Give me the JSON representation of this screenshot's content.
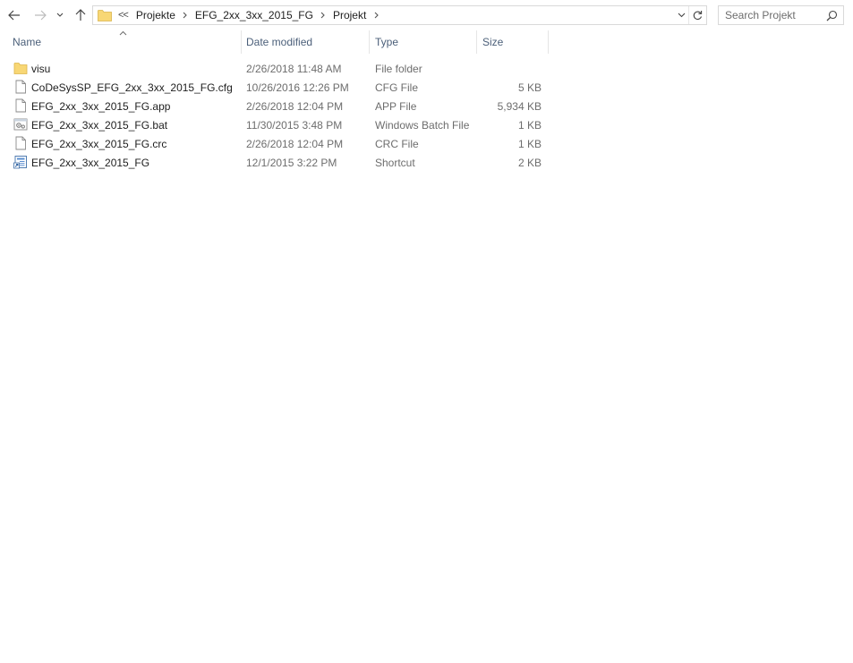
{
  "navigation": {
    "back_icon": "arrow-left-icon",
    "forward_icon": "arrow-right-icon",
    "recent_icon": "chevron-down-icon",
    "up_icon": "arrow-up-icon"
  },
  "address_bar": {
    "folder_icon": "folder-icon",
    "overflow": "<<",
    "crumbs": [
      "Projekte",
      "EFG_2xx_3xx_2015_FG",
      "Projekt"
    ],
    "dropdown_icon": "chevron-down-icon",
    "refresh_icon": "refresh-icon"
  },
  "search": {
    "placeholder": "Search Projekt",
    "value": "",
    "icon": "search-icon"
  },
  "columns": {
    "name": "Name",
    "date_modified": "Date modified",
    "type": "Type",
    "size": "Size",
    "sort_icon": "sort-ascending-icon"
  },
  "files": [
    {
      "name": "visu",
      "date": "2/26/2018 11:48 AM",
      "type": "File folder",
      "size": "",
      "icon": "folder-icon"
    },
    {
      "name": "CoDeSysSP_EFG_2xx_3xx_2015_FG.cfg",
      "date": "10/26/2016 12:26 PM",
      "type": "CFG File",
      "size": "5 KB",
      "icon": "file-icon"
    },
    {
      "name": "EFG_2xx_3xx_2015_FG.app",
      "date": "2/26/2018 12:04 PM",
      "type": "APP File",
      "size": "5,934 KB",
      "icon": "file-icon"
    },
    {
      "name": "EFG_2xx_3xx_2015_FG.bat",
      "date": "11/30/2015 3:48 PM",
      "type": "Windows Batch File",
      "size": "1 KB",
      "icon": "batch-file-icon"
    },
    {
      "name": "EFG_2xx_3xx_2015_FG.crc",
      "date": "2/26/2018 12:04 PM",
      "type": "CRC File",
      "size": "1 KB",
      "icon": "file-icon"
    },
    {
      "name": "EFG_2xx_3xx_2015_FG",
      "date": "12/1/2015 3:22 PM",
      "type": "Shortcut",
      "size": "2 KB",
      "icon": "shortcut-icon"
    }
  ],
  "colors": {
    "header_text": "#4c607a",
    "secondary_text": "#6d6d6d",
    "folder_yellow": "#f8d775",
    "border": "#d9d9d9"
  }
}
